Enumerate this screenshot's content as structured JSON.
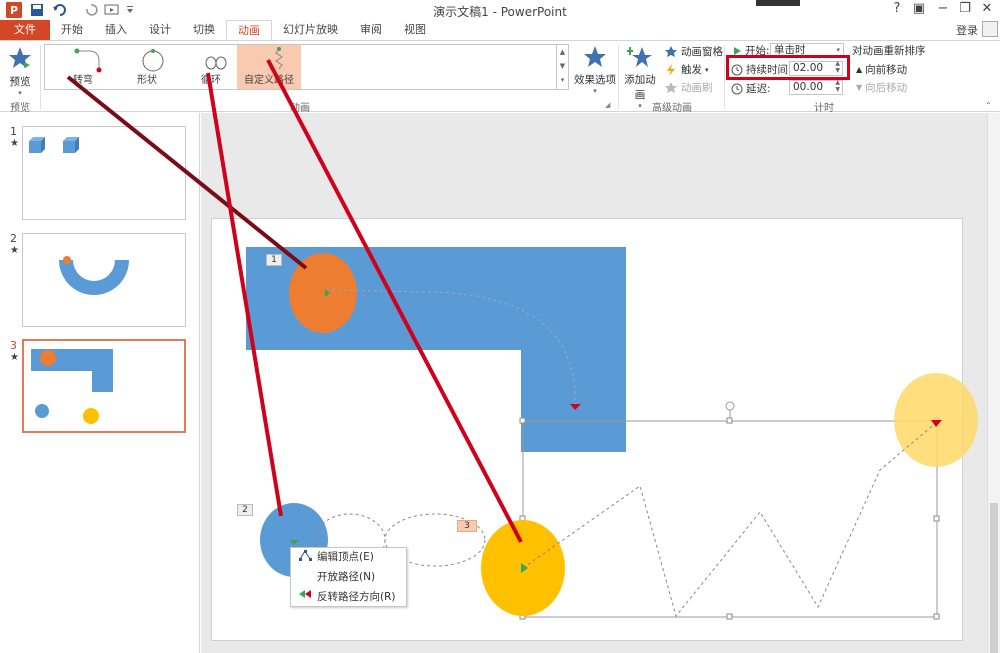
{
  "titlebar": {
    "title": "演示文稿1 - PowerPoint",
    "logo": "P",
    "help": "?",
    "restore_icon": "▣",
    "minimize": "−",
    "maximize": "❐",
    "close": "✕"
  },
  "tabs": [
    "文件",
    "开始",
    "插入",
    "设计",
    "切换",
    "动画",
    "幻灯片放映",
    "审阅",
    "视图"
  ],
  "active_tab": "动画",
  "login": "登录",
  "ribbon": {
    "preview": {
      "label": "预览",
      "group": "预览"
    },
    "gallery": {
      "group": "动画",
      "items": [
        {
          "label": "转弯",
          "icon": "turn-path-icon"
        },
        {
          "label": "形状",
          "icon": "shape-path-icon"
        },
        {
          "label": "循环",
          "icon": "loop-path-icon"
        },
        {
          "label": "自定义路径",
          "icon": "custom-path-icon",
          "selected": true
        }
      ],
      "scroll_up": "▲",
      "scroll_down": "▼",
      "scroll_more": "▾"
    },
    "effect_options": "效果选项",
    "advanced": {
      "group": "高级动画",
      "add_animation": "添加动画",
      "animation_pane": "动画窗格",
      "trigger": "触发",
      "painter": "动画刷"
    },
    "timing": {
      "group": "计时",
      "start_label": "开始:",
      "start_value": "单击时",
      "duration_label": "持续时间:",
      "duration_value": "02.00",
      "delay_label": "延迟:",
      "delay_value": "00.00",
      "reorder_title": "对动画重新排序",
      "move_earlier": "向前移动",
      "move_later": "向后移动"
    }
  },
  "slides": [
    {
      "number": "1",
      "star": "★"
    },
    {
      "number": "2",
      "star": "★"
    },
    {
      "number": "3",
      "star": "★",
      "selected": true
    }
  ],
  "animation_tags": [
    "1",
    "2",
    "3"
  ],
  "context_menu": {
    "items": [
      {
        "label": "编辑顶点(E)",
        "icon": "edit-points-icon"
      },
      {
        "label": "开放路径(N)",
        "icon": "",
        "disabled": true
      },
      {
        "label": "反转路径方向(R)",
        "icon": "reverse-path-icon"
      }
    ]
  },
  "colors": {
    "accent": "#d24726",
    "shape_blue": "#5b9bd5",
    "circle_orange": "#ed7d31",
    "circle_yellow": "#ffc000",
    "annotation_red": "#d0021b"
  }
}
